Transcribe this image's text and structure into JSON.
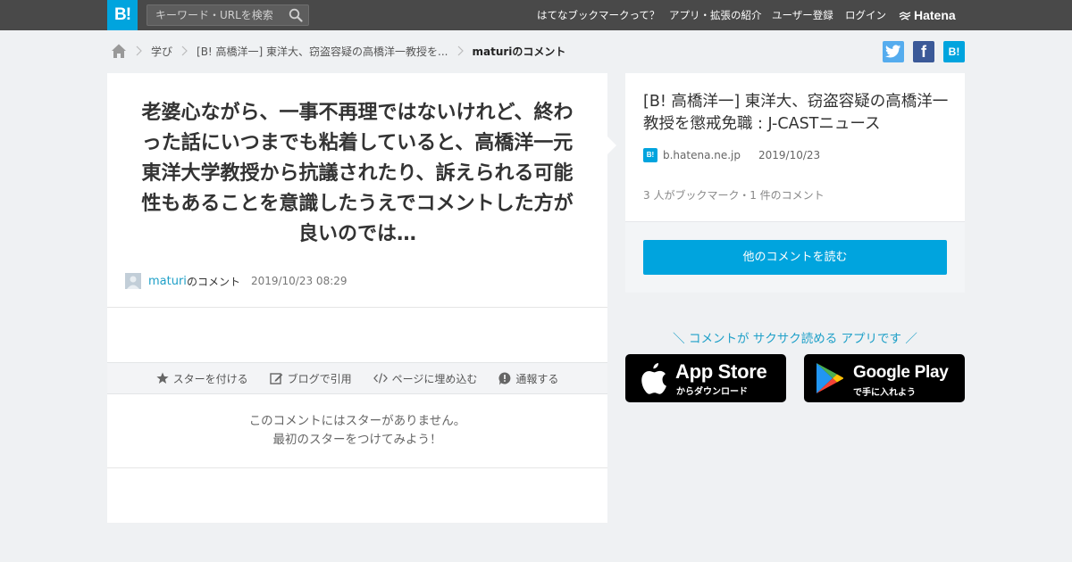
{
  "header": {
    "logo_text": "B!",
    "search_placeholder": "キーワード・URLを検索",
    "nav": [
      "はてなブックマークって？",
      "アプリ・拡張の紹介",
      "ユーザー登録",
      "ログイン"
    ],
    "brand": "Hatena"
  },
  "breadcrumb": {
    "category": "学び",
    "entry": "[B! 高橋洋一] 東洋大、窃盗容疑の高橋洋一教授を...",
    "current": "maturiのコメント"
  },
  "share": {
    "twitter": "t",
    "facebook": "f",
    "hatena": "B!"
  },
  "comment": {
    "text": "老婆心ながら、一事不再理ではないけれど、終わった話にいつまでも粘着していると、高橋洋一元東洋大学教授から抗議されたり、訴えられる可能性もあることを意識したうえでコメントした方が良いのでは…",
    "user": "maturi",
    "user_suffix": "のコメント",
    "timestamp": "2019/10/23 08:29"
  },
  "actions": {
    "star": "スターを付ける",
    "blog": "ブログで引用",
    "embed": "ページに埋め込む",
    "report": "通報する"
  },
  "stars": {
    "line1": "このコメントにはスターがありません。",
    "line2": "最初のスターをつけてみよう！"
  },
  "entry": {
    "title": "[B! 高橋洋一] 東洋大、窃盗容疑の高橋洋一教授を懲戒免職 : J-CASTニュース",
    "favicon": "B!",
    "domain": "b.hatena.ne.jp",
    "date": "2019/10/23",
    "counts": "3 人がブックマーク・1 件のコメント",
    "more_button": "他のコメントを読む"
  },
  "app_promo": {
    "tagline": "＼ コメントが サクサク読める アプリです ／",
    "appstore_main": "App Store",
    "appstore_sub": "からダウンロード",
    "googleplay_main": "Google Play",
    "googleplay_sub": "で手に入れよう"
  },
  "colors": {
    "brand_blue": "#00a4de",
    "topbar": "#494949",
    "link": "#1fa0c8",
    "twitter": "#55acee",
    "facebook": "#3b5998"
  }
}
